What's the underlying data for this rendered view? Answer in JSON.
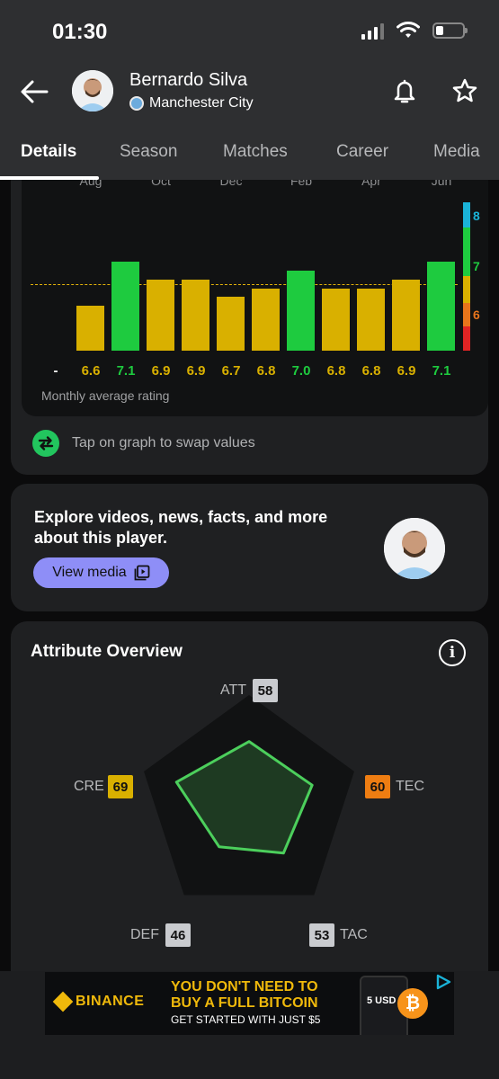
{
  "status_bar": {
    "time": "01:30"
  },
  "header": {
    "player_name": "Bernardo Silva",
    "team_name": "Manchester City"
  },
  "tabs": [
    {
      "label": "Details",
      "active": true
    },
    {
      "label": "Season",
      "active": false
    },
    {
      "label": "Matches",
      "active": false
    },
    {
      "label": "Career",
      "active": false
    },
    {
      "label": "Media",
      "active": false
    }
  ],
  "chart_data": {
    "type": "bar",
    "categories": [
      "Aug",
      "Oct",
      "Dec",
      "Feb",
      "Apr",
      "Jun"
    ],
    "values": [
      null,
      6.6,
      7.1,
      6.9,
      6.9,
      6.7,
      6.8,
      7.0,
      6.8,
      6.8,
      6.9,
      7.1
    ],
    "value_labels": [
      "-",
      "6.6",
      "7.1",
      "6.9",
      "6.9",
      "6.7",
      "6.8",
      "7.0",
      "6.8",
      "6.8",
      "6.9",
      "7.1"
    ],
    "scale_labels": [
      "8",
      "7",
      "6"
    ],
    "caption": "Monthly average rating",
    "colors": {
      "high": "#1ecb3f",
      "mid": "#d9b000",
      "low": "#e8741b",
      "red": "#e02424",
      "top": "#1ab3d8"
    }
  },
  "swap_hint": "Tap on graph to swap values",
  "media_card": {
    "text": "Explore videos, news, facts, and more about this player.",
    "button_label": "View media"
  },
  "attributes": {
    "title": "Attribute Overview",
    "items": [
      {
        "label": "ATT",
        "value": "58"
      },
      {
        "label": "TEC",
        "value": "60"
      },
      {
        "label": "TAC",
        "value": "53"
      },
      {
        "label": "DEF",
        "value": "46"
      },
      {
        "label": "CRE",
        "value": "69"
      }
    ]
  },
  "ad": {
    "brand": "BINANCE",
    "headline_line1": "YOU DON'T NEED TO",
    "headline_line2": "BUY A FULL BITCOIN",
    "subline": "GET STARTED WITH JUST $5",
    "phone_amount": "5 USD"
  }
}
